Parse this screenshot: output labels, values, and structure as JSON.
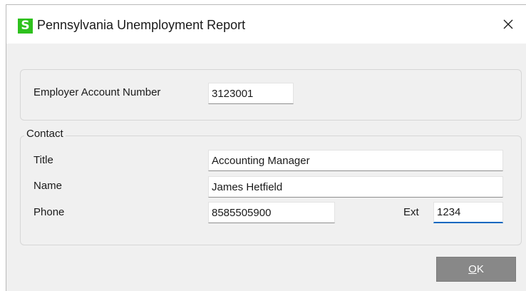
{
  "window": {
    "title": "Pennsylvania Unemployment Report",
    "app_icon_letter": "S",
    "app_icon_color": "#2ec11d"
  },
  "employer": {
    "account_number_label": "Employer Account Number",
    "account_number_value": "3123001"
  },
  "contact": {
    "group_label": "Contact",
    "title_label": "Title",
    "title_value": "Accounting Manager",
    "name_label": "Name",
    "name_value": "James Hetfield",
    "phone_label": "Phone",
    "phone_value": "8585505900",
    "ext_label": "Ext",
    "ext_value": "1234"
  },
  "buttons": {
    "ok_mnemonic": "O",
    "ok_rest": "K"
  },
  "colors": {
    "ok_button_bg": "#888888",
    "focus_underline": "#0067c0"
  }
}
